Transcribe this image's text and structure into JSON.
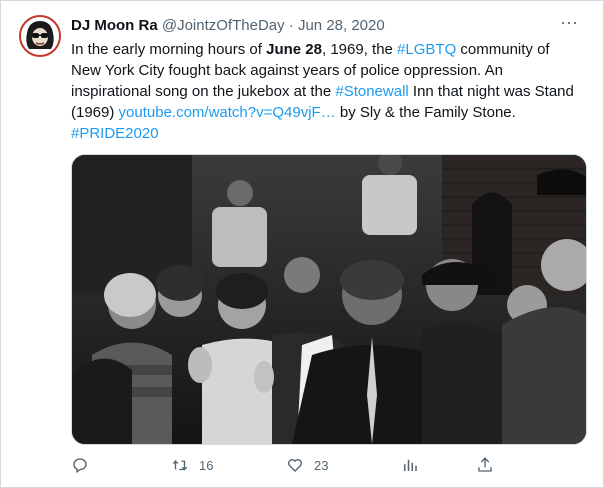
{
  "tweet": {
    "author_name": "DJ Moon Ra",
    "handle": "@JointzOfTheDay",
    "separator": "·",
    "date": "Jun 28, 2020",
    "more_label": "···",
    "text": {
      "p1": "In the early morning hours of ",
      "bold": "June 28",
      "p2": ", 1969, the ",
      "hashtag_lgbtq": "#LGBTQ",
      "p3": " community of New York City fought back against years of police oppression. An inspirational song on the jukebox at the ",
      "hashtag_stonewall": "#Stonewall",
      "p4": " Inn that night was Stand (1969) ",
      "url": "youtube.com/watch?v=Q49vjF…",
      "p5": " by Sly & the Family Stone.",
      "hashtag_pride": "#PRIDE2020"
    },
    "image": {
      "description_icon": "photo",
      "tone": "black-and-white"
    },
    "actions": {
      "reply_count": "",
      "retweet_count": "16",
      "like_count": "23",
      "views_count": "",
      "share_label": ""
    }
  },
  "colors": {
    "link": "#1d9bf0",
    "muted": "#536471",
    "text": "#0f1419",
    "border": "#cfd9de",
    "avatar_ring": "#c0392b"
  }
}
